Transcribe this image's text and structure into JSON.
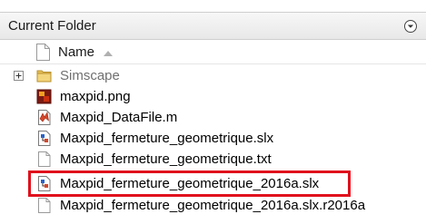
{
  "panel": {
    "title": "Current Folder",
    "column_header": "Name"
  },
  "files": [
    {
      "name": "Simscape",
      "type": "folder-icon"
    },
    {
      "name": "maxpid.png",
      "type": "image-file-icon"
    },
    {
      "name": "Maxpid_DataFile.m",
      "type": "m-file-icon"
    },
    {
      "name": "Maxpid_fermeture_geometrique.slx",
      "type": "slx-file-icon"
    },
    {
      "name": "Maxpid_fermeture_geometrique.txt",
      "type": "txt-file-icon"
    },
    {
      "name": "Maxpid_fermeture_geometrique_2016a.slx",
      "type": "slx-file-icon"
    },
    {
      "name": "Maxpid_fermeture_geometrique_2016a.slx.r2016a",
      "type": "generic-file-icon"
    }
  ],
  "highlight_color": "#e0101c"
}
